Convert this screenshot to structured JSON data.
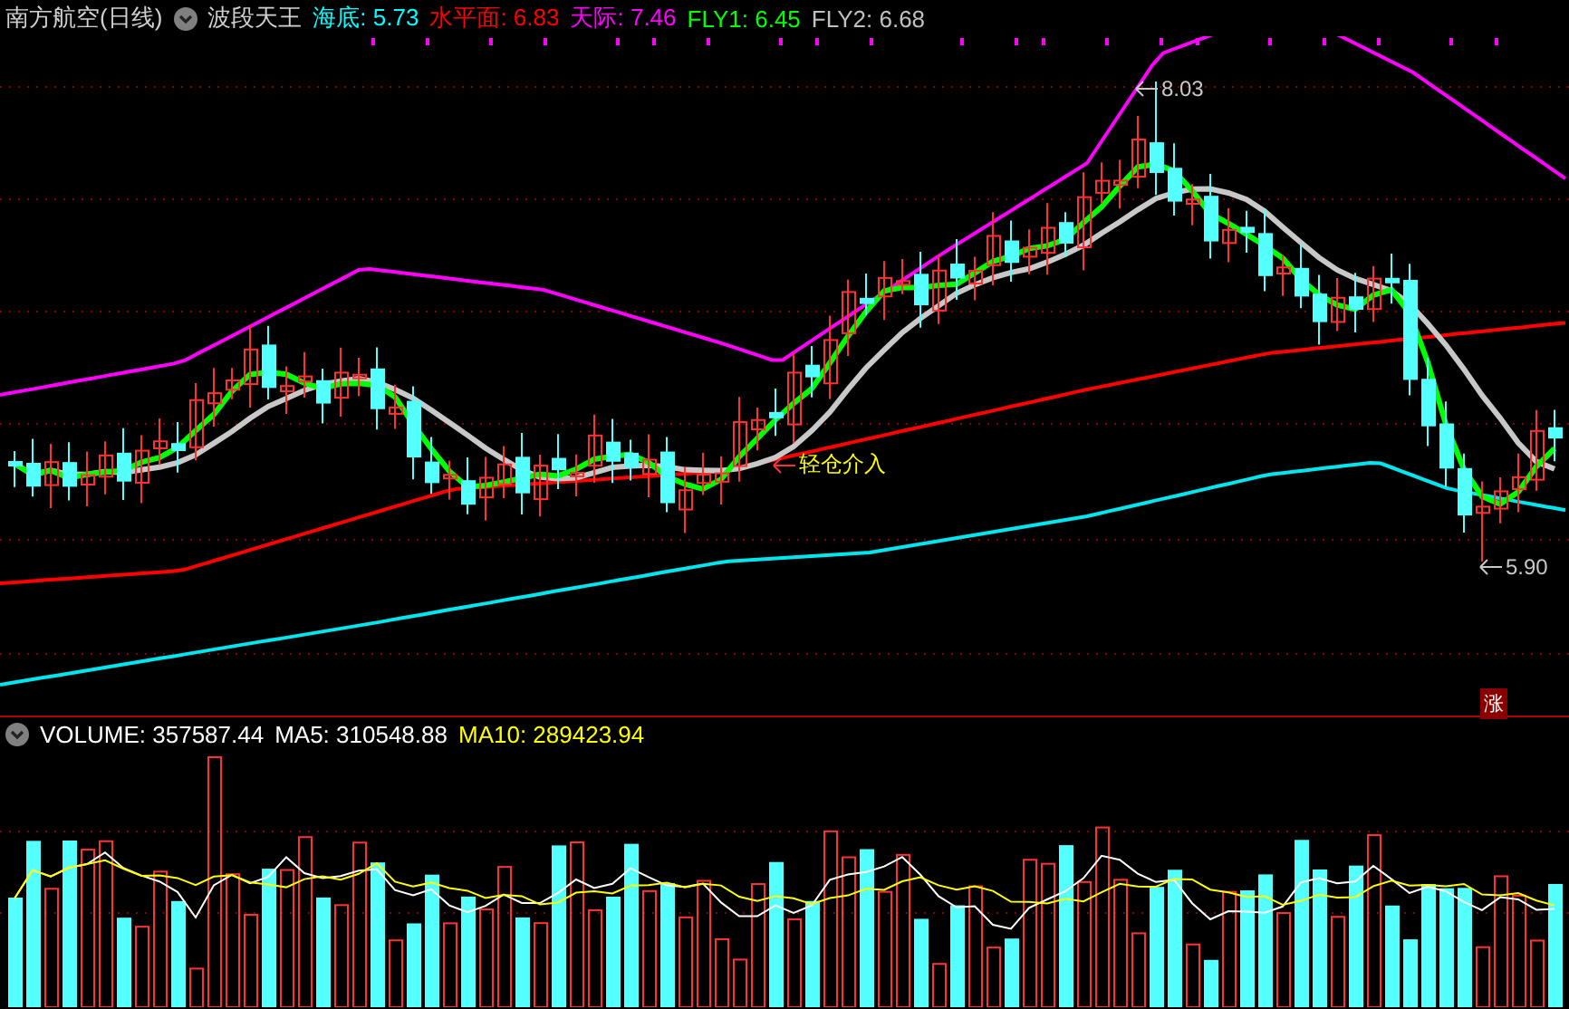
{
  "header": {
    "title": "南方航空(日线)",
    "indicator": "波段天王",
    "legend": [
      {
        "text": "海底: 5.73",
        "color": "#00ffff"
      },
      {
        "text": "水平面: 6.83",
        "color": "#ff0000"
      },
      {
        "text": "天际: 7.46",
        "color": "#ff00ff"
      },
      {
        "text": "FLY1: 6.45",
        "color": "#00ff00"
      },
      {
        "text": "FLY2: 6.68",
        "color": "#c0c0c0"
      }
    ]
  },
  "price_chart": {
    "annotations": [
      {
        "kind": "high",
        "text": "8.03"
      },
      {
        "kind": "low",
        "text": "5.90"
      },
      {
        "kind": "signal",
        "text": "轻仓介入"
      }
    ],
    "badge": "涨"
  },
  "volume": {
    "legend": [
      {
        "text": "VOLUME: 357587.44",
        "color": "#ffffff"
      },
      {
        "text": "MA5: 310548.88",
        "color": "#ffffff"
      },
      {
        "text": "MA10: 289423.94",
        "color": "#ffff00"
      }
    ]
  }
}
